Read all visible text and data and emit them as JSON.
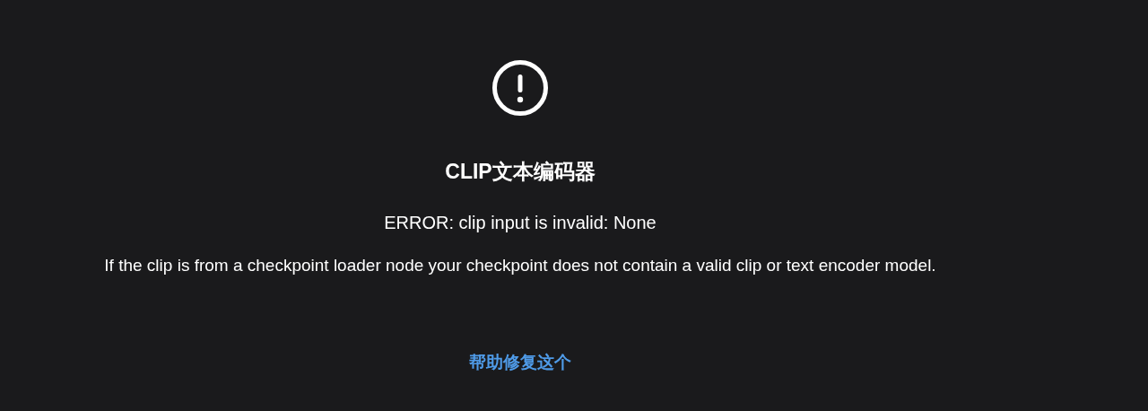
{
  "title": "CLIP文本编码器",
  "error": "ERROR: clip input is invalid: None",
  "description": "If the clip is from a checkpoint loader node your checkpoint does not contain a valid clip or text encoder model.",
  "link": "帮助修复这个"
}
